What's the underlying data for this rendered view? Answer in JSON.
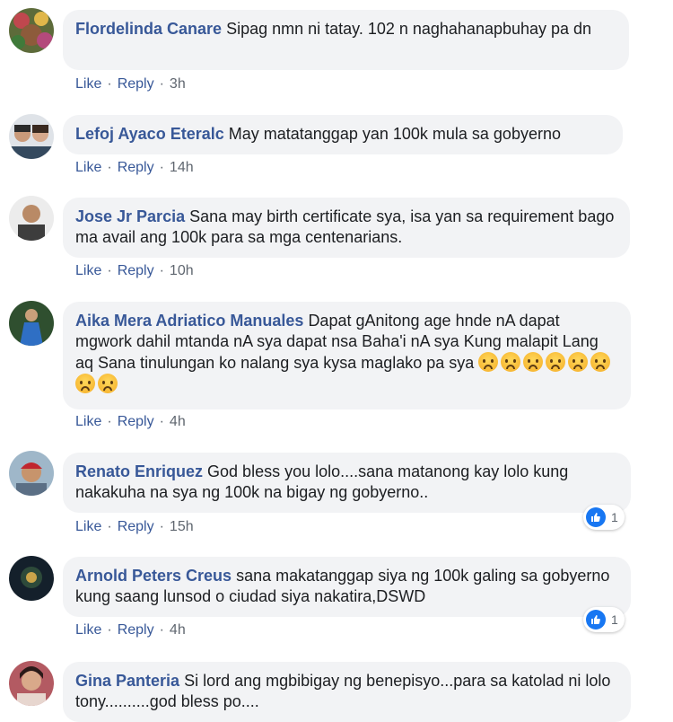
{
  "actions": {
    "like": "Like",
    "reply": "Reply",
    "separator": "·"
  },
  "comments": [
    {
      "author": "Flordelinda Canare",
      "text": "Sipag nmn ni tatay. 102 n naghahanapbuhay pa dn",
      "time": "3h"
    },
    {
      "author": "Lefoj Ayaco Eteralc",
      "text": "May matatanggap yan 100k mula sa gobyerno",
      "time": "14h"
    },
    {
      "author": "Jose Jr Parcia",
      "text": "Sana may birth certificate sya, isa yan sa requirement bago ma avail ang 100k para sa mga centenarians.",
      "time": "10h"
    },
    {
      "author": "Aika Mera Adriatico Manuales",
      "text": "Dapat gAnitong age hnde nA dapat mgwork dahil mtanda nA sya dapat nsa Baha'i nA sya Kung malapit Lang aq Sana tinulungan ko nalang sya kysa maglako pa sya",
      "emoji_count": 8,
      "emoji": "disappointed-face-emoji",
      "time": "4h"
    },
    {
      "author": "Renato Enriquez",
      "text": "God bless you lolo....sana matanong kay lolo kung nakakuha na sya ng 100k na bigay ng gobyerno..",
      "time": "15h",
      "reactions": "1",
      "reaction_icon": "like-icon"
    },
    {
      "author": "Arnold Peters Creus",
      "text": "sana makatanggap siya ng 100k galing sa gobyerno kung saang lunsod o ciudad siya nakatira,DSWD",
      "time": "4h",
      "reactions": "1",
      "reaction_icon": "like-icon"
    },
    {
      "author": "Gina Panteria",
      "text": "Si lord ang mgbibigay ng benepisyo...para sa katolad ni lolo tony..........god bless po...."
    }
  ],
  "colors": {
    "link": "#385898",
    "bubble": "#f2f3f5",
    "meta": "#606770",
    "like_blue": "#1877f2"
  }
}
